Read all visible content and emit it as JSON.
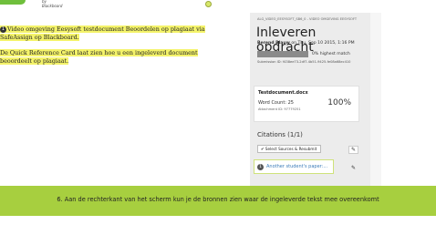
{
  "logo": {
    "text": "by Blackboard"
  },
  "instructions": [
    {
      "step": "1",
      "text": "Video omgeving Eesysoft testdocument Beoordelen op plagiaat via SafeAssign op Blackboard."
    },
    {
      "step": "",
      "text": "De Quick Reference Card laat zien hoe u een ingeleverd document beoordeelt op plagiaat."
    }
  ],
  "panel": {
    "breadcrumb": "ALG_VIDEO_EESYSOFT_SB6_0 - VIDEO OMGEVING EESYSOFT",
    "title": "Inleveren opdracht",
    "author": "Berend Blauw",
    "submitted": "on Thu, Sep 10 2015, 1:16 PM",
    "match_text": "0% highest match",
    "match_percent": 0,
    "submission_id": "Submission ID: f438ee73-2df7-4b51-9425-fe08a68ec410"
  },
  "document": {
    "name": "Testdocument.docx",
    "word_count": "Word Count: 25",
    "attachment_id": "Attachment ID: 97779251",
    "percent": "100%"
  },
  "citations": {
    "heading": "Citations (1/1)",
    "select_button": "✔ Select Sources & Resubmit",
    "items": [
      {
        "num": "1",
        "label": "Another student's paper:..."
      }
    ]
  },
  "banner": {
    "text": "6. Aan de rechterkant van het scherm kun je de bronnen zien waar de ingeleverde tekst mee overeenkomt"
  },
  "colors": {
    "banner": "#a7cf3f",
    "highlight": "#f4f36a",
    "link": "#3a7bb8"
  }
}
